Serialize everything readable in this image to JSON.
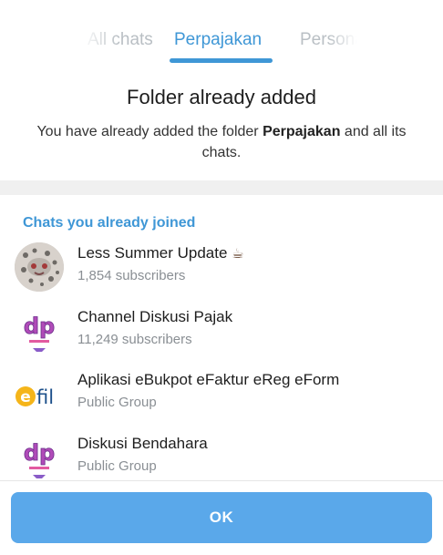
{
  "tabs": [
    {
      "label": "All chats"
    },
    {
      "label": "Perpajakan"
    },
    {
      "label": "Personal"
    }
  ],
  "header": {
    "title": "Folder already added",
    "desc_before": "You have already added the folder ",
    "desc_folder": "Perpajakan",
    "desc_after": " and all its chats."
  },
  "section_label": "Chats you already joined",
  "chats": [
    {
      "name": "Less Summer Update",
      "sub": "1,854 subscribers",
      "emoji": "☕"
    },
    {
      "name": "Channel Diskusi Pajak",
      "sub": "11,249 subscribers"
    },
    {
      "name": "Aplikasi eBukpot eFaktur eReg eForm",
      "sub": "Public Group"
    },
    {
      "name": "Diskusi Bendahara",
      "sub": "Public Group"
    }
  ],
  "logo_text": {
    "dp": "dp",
    "efil_e": "e",
    "efil_fil": "fil"
  },
  "ok_label": "OK",
  "colors": {
    "accent": "#3f97d6",
    "button": "#5aa8ea"
  }
}
